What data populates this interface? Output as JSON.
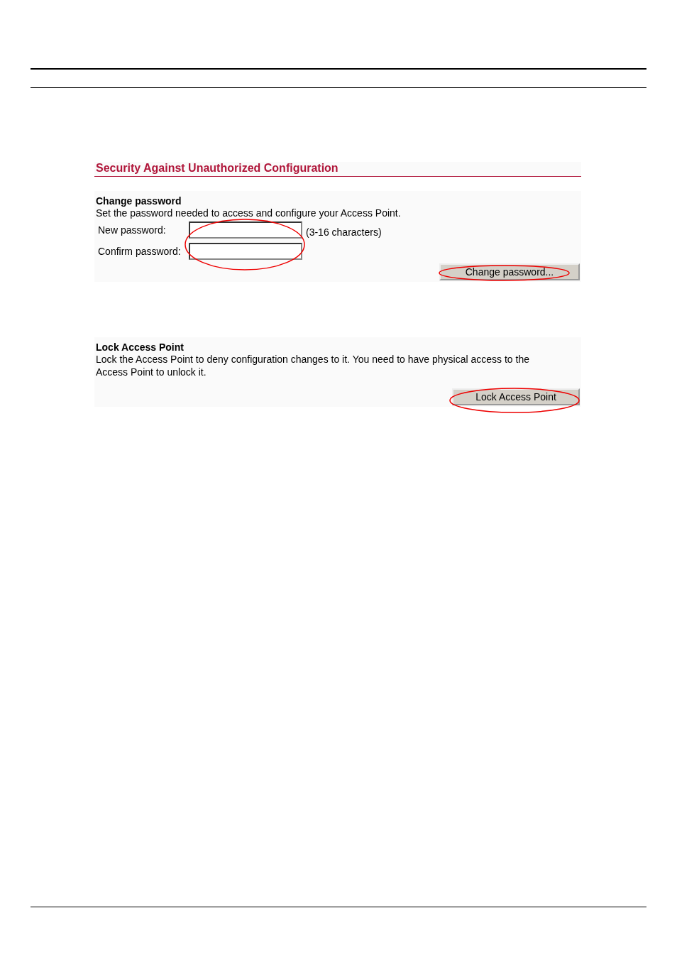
{
  "title": "Security Against Unauthorized Configuration",
  "change_password": {
    "heading": "Change password",
    "description": "Set the password needed to access and configure your Access Point.",
    "fields": [
      {
        "label": "New password:",
        "hint": "(3-16 characters)"
      },
      {
        "label": "Confirm password:"
      }
    ],
    "button": "Change password..."
  },
  "lock": {
    "heading": "Lock Access Point",
    "description": "Lock the Access Point to deny configuration changes to it. You need to have physical access to the Access Point to unlock it.",
    "button": "Lock Access Point"
  }
}
